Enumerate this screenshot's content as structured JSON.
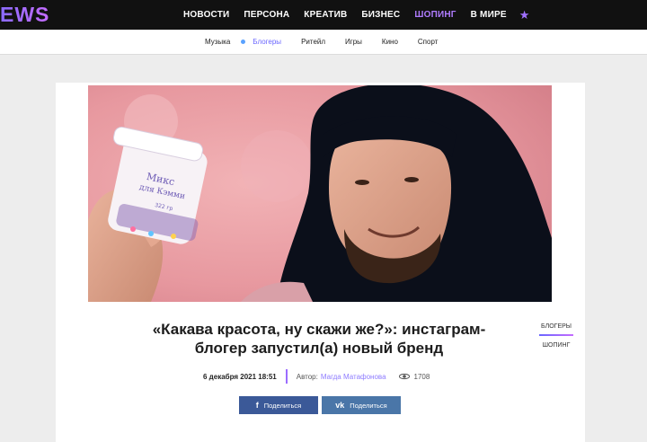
{
  "header": {
    "logo": "EWS",
    "nav": [
      {
        "label": "Новости",
        "active": false
      },
      {
        "label": "Персона",
        "active": false
      },
      {
        "label": "Креатив",
        "active": false
      },
      {
        "label": "Бизнес",
        "active": false
      },
      {
        "label": "Шопинг",
        "active": true
      },
      {
        "label": "В мире",
        "active": false
      }
    ]
  },
  "subnav": [
    {
      "label": "Музыка",
      "active": false
    },
    {
      "label": "Блогеры",
      "active": true
    },
    {
      "label": "Ритейл",
      "active": false
    },
    {
      "label": "Игры",
      "active": false
    },
    {
      "label": "Кино",
      "active": false
    },
    {
      "label": "Спорт",
      "active": false
    }
  ],
  "article": {
    "title": "«Какава красота, ну скажи же?»: инстаграм-блогер запустил(а) новый бренд",
    "date": "6 декабря 2021 18:51",
    "author_label": "Автор:",
    "author": "Магда Матафонова",
    "views": "1708",
    "jar_label_line1": "Микс",
    "jar_label_line2": "для Кэмми",
    "jar_weight": "322 гр"
  },
  "share": {
    "facebook": "Поделиться",
    "vk": "Поделиться",
    "fb_icon": "f",
    "vk_icon": "vk"
  },
  "tags": [
    "Блогеры",
    "Шопинг"
  ],
  "colors": {
    "accent": "#a070ff",
    "topbar": "#111111",
    "facebook": "#3b5998",
    "vk": "#4a76a8"
  }
}
